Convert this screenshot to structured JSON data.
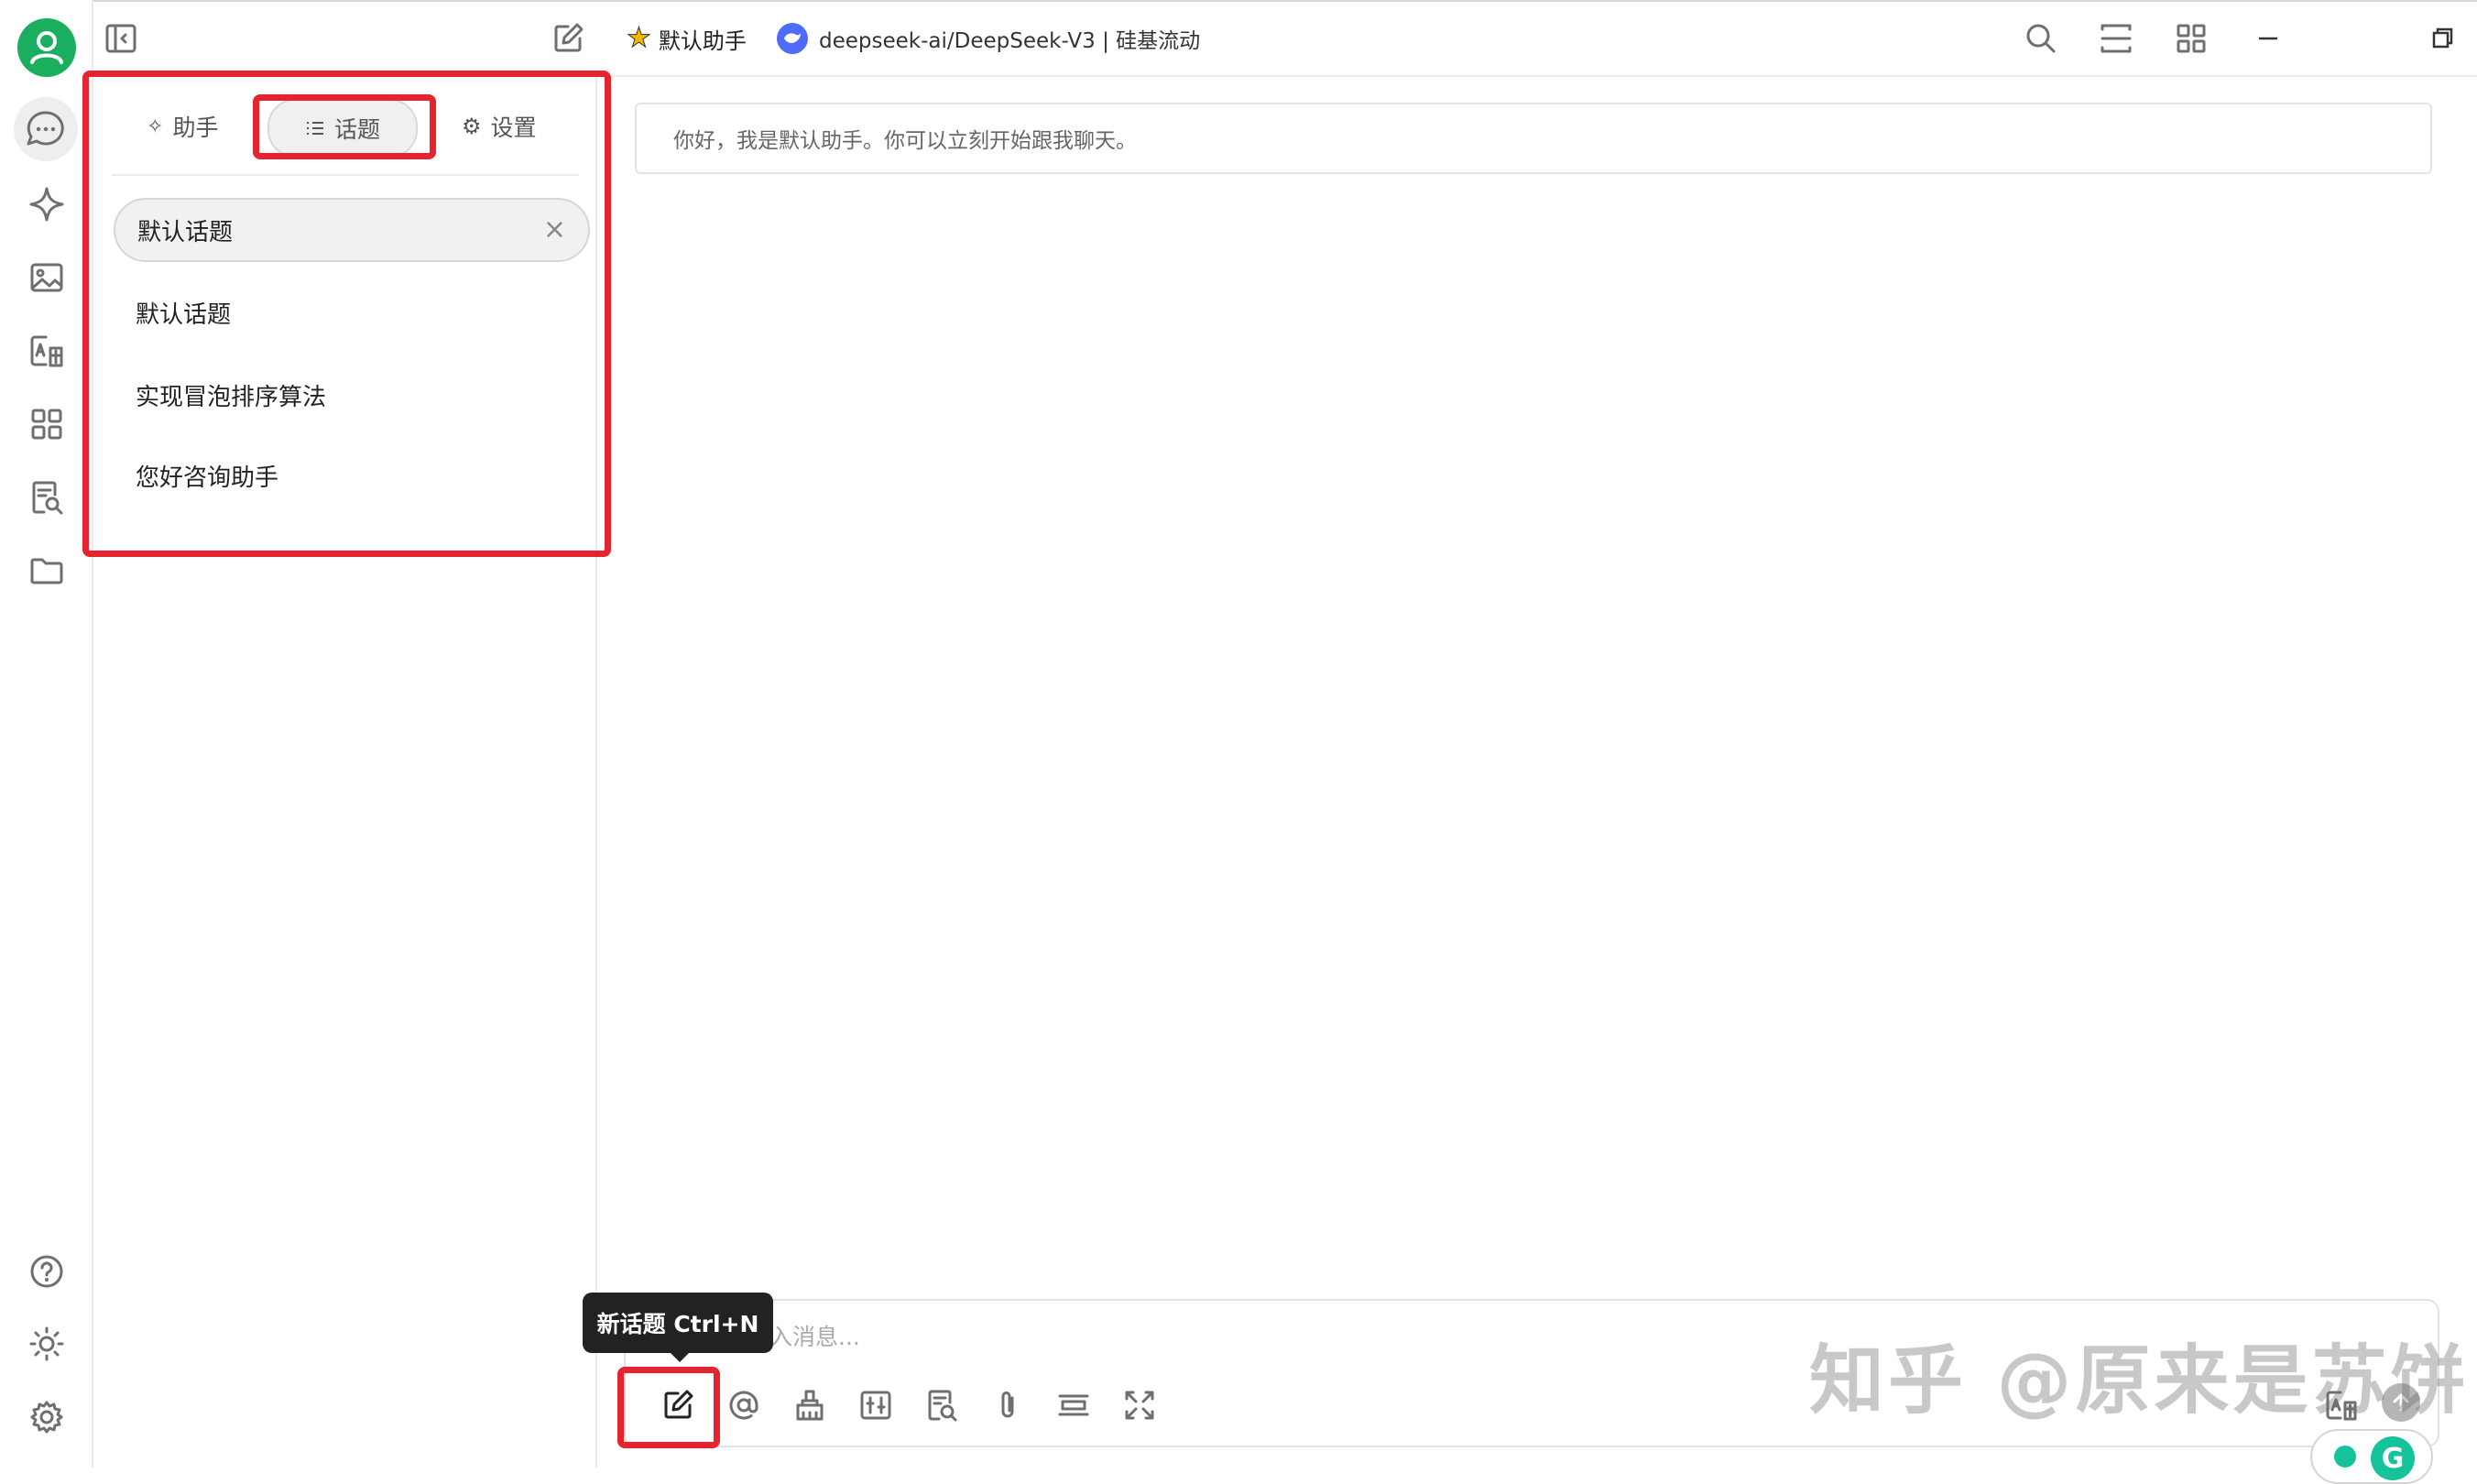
{
  "header": {
    "assistant_name": "默认助手",
    "model_name": "deepseek-ai/DeepSeek-V3 | 硅基流动"
  },
  "panel": {
    "tabs": [
      {
        "label": "助手",
        "icon": "sparkle-icon"
      },
      {
        "label": "话题",
        "icon": "list-icon"
      },
      {
        "label": "设置",
        "icon": "gear-icon"
      }
    ],
    "active_tab": "话题",
    "topics": [
      "默认话题",
      "默认话题",
      "实现冒泡排序算法",
      "您好咨询助手"
    ]
  },
  "chat": {
    "greeting": "你好，我是默认助手。你可以立刻开始跟我聊天。",
    "input_placeholder": "入消息..."
  },
  "tooltip": {
    "text": "新话题 Ctrl+N"
  },
  "watermark": "知乎 @原来是苏饼",
  "colors": {
    "avatar": "#1aae5f",
    "highlight": "#e5242f",
    "tooltip_bg": "#222222",
    "model_badge": "#4d6bfe"
  }
}
